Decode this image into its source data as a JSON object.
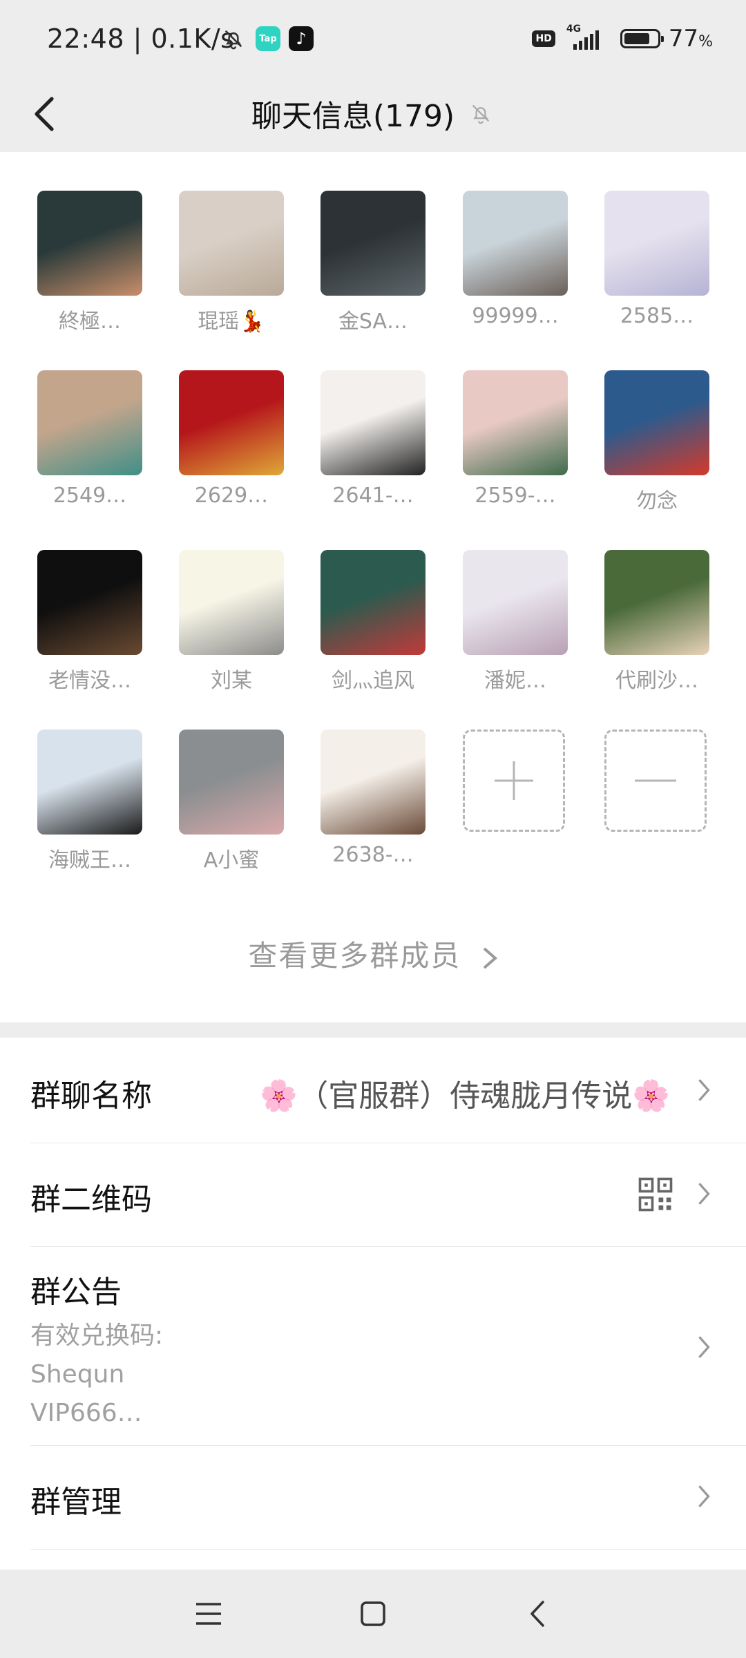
{
  "status_bar": {
    "time": "22:48 | 0.1K/s",
    "tap_label": "Tap",
    "hd": "HD",
    "network": "4G",
    "battery_value": "77",
    "battery_unit": "%"
  },
  "header": {
    "title": "聊天信息(179)"
  },
  "members": [
    {
      "name": "終極…",
      "colors": [
        "#2a3a3a",
        "#c88f6a"
      ]
    },
    {
      "name": "琨瑶💃",
      "colors": [
        "#d9cfc6",
        "#b9a998"
      ]
    },
    {
      "name": "金SA…",
      "colors": [
        "#2c3236",
        "#5d666a"
      ]
    },
    {
      "name": "99999…",
      "colors": [
        "#c9d4da",
        "#6b5f58"
      ]
    },
    {
      "name": "2585…",
      "colors": [
        "#e6e1ee",
        "#b5b3d4"
      ]
    },
    {
      "name": "2549…",
      "colors": [
        "#c3a58c",
        "#3f8f88"
      ]
    },
    {
      "name": "2629…",
      "colors": [
        "#b5161b",
        "#e0a838"
      ]
    },
    {
      "name": "2641-…",
      "colors": [
        "#f3f0ed",
        "#222222"
      ]
    },
    {
      "name": "2559-…",
      "colors": [
        "#e8c9c4",
        "#3d6b4a"
      ]
    },
    {
      "name": "勿念",
      "colors": [
        "#2d5a8c",
        "#d43a2a"
      ]
    },
    {
      "name": "老情没…",
      "colors": [
        "#0f0f0f",
        "#6a4a32"
      ]
    },
    {
      "name": "刘某",
      "colors": [
        "#f7f5e6",
        "#8c8c8c"
      ]
    },
    {
      "name": "剑灬追风",
      "colors": [
        "#2d5a4e",
        "#c23a3a"
      ]
    },
    {
      "name": "潘妮…",
      "colors": [
        "#eae6ee",
        "#b8a0b4"
      ]
    },
    {
      "name": "代刷沙…",
      "colors": [
        "#4a6a3a",
        "#e8d2b8"
      ]
    },
    {
      "name": "海贼王…",
      "colors": [
        "#d8e2ec",
        "#1a1a1a"
      ]
    },
    {
      "name": "A小蜜",
      "colors": [
        "#8a8e90",
        "#d9a9ab"
      ]
    },
    {
      "name": "2638-…",
      "colors": [
        "#f4efe8",
        "#6a4a38"
      ]
    }
  ],
  "view_more": "查看更多群成员",
  "settings": {
    "group_name_label": "群聊名称",
    "group_name_value": "🌸（官服群）侍魂胧月传说🌸",
    "qr_label": "群二维码",
    "notice_label": "群公告",
    "notice_lines": [
      "有效兑换码:",
      "Shequn",
      "VIP666…"
    ],
    "manage_label": "群管理"
  }
}
